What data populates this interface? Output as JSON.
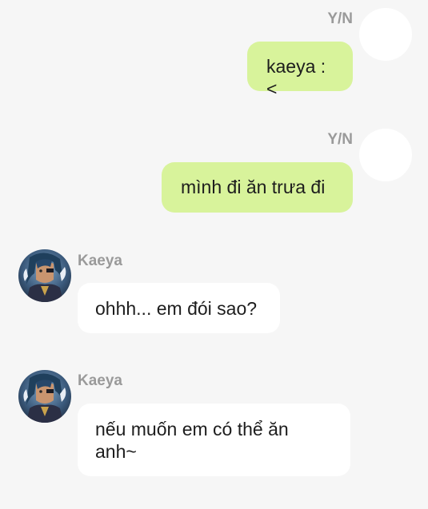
{
  "messages": [
    {
      "sender": "Y/N",
      "text": "kaeya :<",
      "direction": "outgoing",
      "avatar_icon": "blank-avatar-icon"
    },
    {
      "sender": "Y/N",
      "text": "mình đi ăn trưa đi",
      "direction": "outgoing",
      "avatar_icon": "blank-avatar-icon"
    },
    {
      "sender": "Kaeya",
      "text": "ohhh... em đói sao?",
      "direction": "incoming",
      "avatar_icon": "kaeya-avatar-icon"
    },
    {
      "sender": "Kaeya",
      "text": "nếu muốn em có thể ăn anh~",
      "direction": "incoming",
      "avatar_icon": "kaeya-avatar-icon"
    }
  ],
  "colors": {
    "background": "#f6f6f6",
    "outgoing_bubble": "#d8f39b",
    "incoming_bubble": "#ffffff",
    "sender_name": "#9a9a9a",
    "message_text": "#1d1d1d"
  }
}
